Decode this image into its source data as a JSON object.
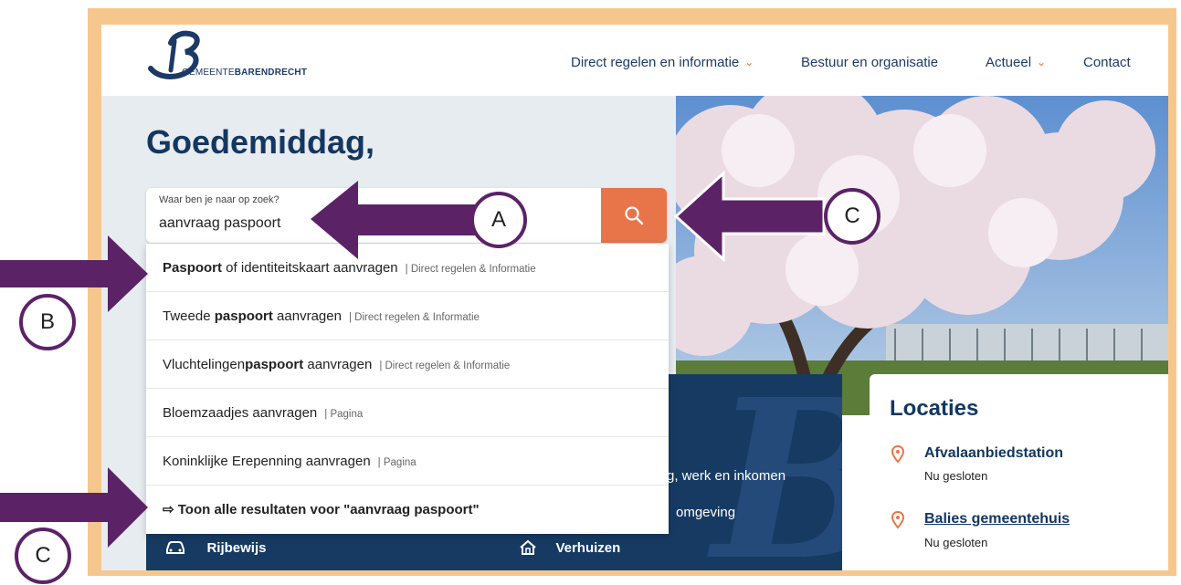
{
  "header": {
    "logo_prefix": "GEMEENTE",
    "logo_name": "BARENDRECHT",
    "nav": [
      {
        "label": "Direct regelen en informatie",
        "has_dropdown": true
      },
      {
        "label": "Bestuur en organisatie",
        "has_dropdown": false
      },
      {
        "label": "Actueel",
        "has_dropdown": true
      },
      {
        "label": "Contact",
        "has_dropdown": false
      }
    ]
  },
  "hero": {
    "greeting": "Goedemiddag,"
  },
  "search": {
    "label": "Waar ben je naar op zoek?",
    "value": "aanvraag paspoort",
    "button_icon": "search-icon"
  },
  "suggestions": [
    {
      "pre": "",
      "bold": "Paspoort",
      "post": " of identiteitskaart aanvragen",
      "category": "| Direct regelen & Informatie"
    },
    {
      "pre": "Tweede ",
      "bold": "paspoort",
      "post": " aanvragen",
      "category": "| Direct regelen & Informatie"
    },
    {
      "pre": "Vluchtelingen",
      "bold": "paspoort",
      "post": " aanvragen",
      "category": "| Direct regelen & Informatie"
    },
    {
      "pre": "Bloemzaadjes aanvragen",
      "bold": "",
      "post": "",
      "category": "| Pagina"
    },
    {
      "pre": "Koninklijke Erepenning aanvragen",
      "bold": "",
      "post": "",
      "category": "| Pagina"
    }
  ],
  "show_all": {
    "arrow": "⇨",
    "label": "Toon alle resultaten voor \"aanvraag paspoort\""
  },
  "bluecard": {
    "partial_1": "g, werk en inkomen",
    "partial_2": "omgeving",
    "link_rijbewijs": "Rijbewijs",
    "link_verhuizen": "Verhuizen"
  },
  "locaties": {
    "title": "Locaties",
    "items": [
      {
        "name": "Afvalaanbiedstation",
        "status": "Nu gesloten"
      },
      {
        "name": "Balies gemeentehuis",
        "status": "Nu gesloten"
      }
    ]
  },
  "annotations": {
    "label_a": "A",
    "label_b": "B",
    "label_c_top": "C",
    "label_c_bottom": "C"
  },
  "colors": {
    "frame": "#f6c78d",
    "navy": "#143760",
    "accent_orange": "#e8744a",
    "annotation_purple": "#5b2366"
  }
}
